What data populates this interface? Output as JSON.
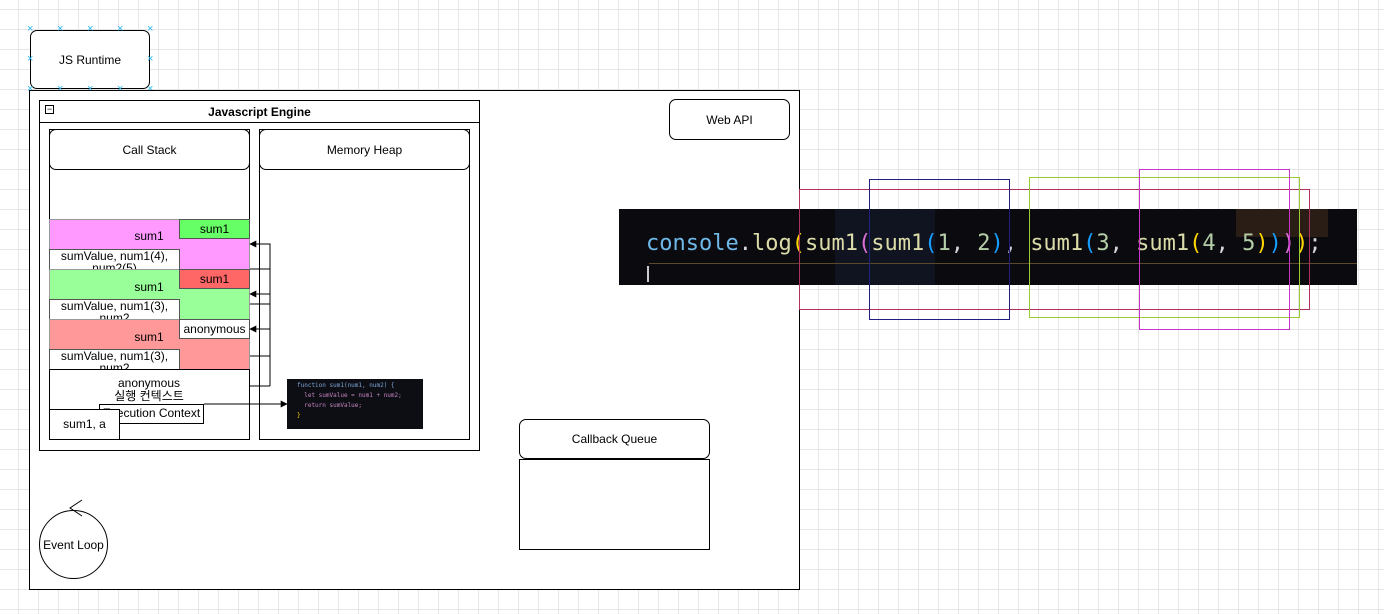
{
  "js_runtime": {
    "label": "JS Runtime"
  },
  "engine": {
    "title": "Javascript Engine",
    "collapse_symbol": "−"
  },
  "call_stack": {
    "label": "Call Stack",
    "frames": [
      {
        "tag": "sum1",
        "title": "sum1",
        "vars": "sumValue, num1(4), num2(5)",
        "tag_color": "#66ff66",
        "bg_color": "#ff99ff"
      },
      {
        "tag": "sum1",
        "title": "sum1",
        "vars": "sumValue, num1(3), num2",
        "tag_color": "#ff6666",
        "bg_color": "#99ff99"
      },
      {
        "tag": "anonymous",
        "title": "sum1",
        "vars": "sumValue, num1(3), num2",
        "tag_color": "#ffffff",
        "bg_color": "#ff9999"
      }
    ],
    "global": {
      "title": "anonymous",
      "subtitle": "실행 컨텍스트",
      "context": "Execution Context",
      "vars": "sum1, a"
    }
  },
  "memory_heap": {
    "label": "Memory Heap"
  },
  "snippet": {
    "lines": [
      "function sum1(num1, num2) {",
      "  let sumValue = num1 + num2;",
      "  return sumValue;",
      "}"
    ]
  },
  "web_api": {
    "label": "Web API"
  },
  "callback_queue": {
    "label": "Callback Queue"
  },
  "event_loop": {
    "label": "Event Loop"
  },
  "console_code": {
    "tokens": [
      {
        "t": "console",
        "c": "#6fb8e8"
      },
      {
        "t": ".",
        "c": "#d4d4d4"
      },
      {
        "t": "log",
        "c": "#dcdcaa"
      },
      {
        "t": "(",
        "c": "#ffd700"
      },
      {
        "t": "sum1",
        "c": "#dcdcaa"
      },
      {
        "t": "(",
        "c": "#da70d6"
      },
      {
        "t": "sum1",
        "c": "#dcdcaa"
      },
      {
        "t": "(",
        "c": "#179fff"
      },
      {
        "t": "1",
        "c": "#b5cea8"
      },
      {
        "t": ", ",
        "c": "#d4d4d4"
      },
      {
        "t": "2",
        "c": "#b5cea8"
      },
      {
        "t": ")",
        "c": "#179fff"
      },
      {
        "t": ", ",
        "c": "#d4d4d4"
      },
      {
        "t": "sum1",
        "c": "#dcdcaa"
      },
      {
        "t": "(",
        "c": "#179fff"
      },
      {
        "t": "3",
        "c": "#b5cea8"
      },
      {
        "t": ", ",
        "c": "#d4d4d4"
      },
      {
        "t": "sum1",
        "c": "#dcdcaa"
      },
      {
        "t": "(",
        "c": "#ffd700"
      },
      {
        "t": "4",
        "c": "#b5cea8"
      },
      {
        "t": ", ",
        "c": "#d4d4d4"
      },
      {
        "t": "5",
        "c": "#b5cea8"
      },
      {
        "t": ")",
        "c": "#ffd700"
      },
      {
        "t": ")",
        "c": "#179fff"
      },
      {
        "t": ")",
        "c": "#da70d6"
      },
      {
        "t": ")",
        "c": "#ffd700"
      },
      {
        "t": ";",
        "c": "#d4d4d4"
      }
    ]
  },
  "highlight_colors": [
    "#b03060",
    "#202080",
    "#99cc33",
    "#cc33cc"
  ]
}
